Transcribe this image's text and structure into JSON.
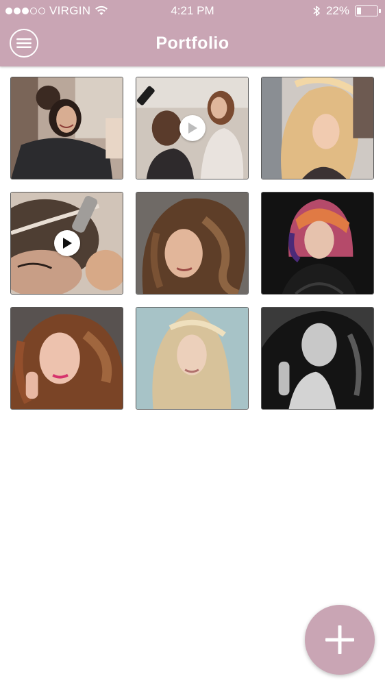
{
  "status_bar": {
    "carrier": "VIRGIN",
    "signal_bars_filled": 3,
    "signal_bars_total": 5,
    "time": "4:21 PM",
    "battery_percent_text": "22%",
    "battery_level": 0.22
  },
  "nav": {
    "title": "Portfolio",
    "menu_icon": "hamburger-menu-icon"
  },
  "colors": {
    "header_bg": "#c9a5b4",
    "fab_bg": "#c9a5b4"
  },
  "portfolio": {
    "items": [
      {
        "kind": "photo",
        "subject": "salon client smiling"
      },
      {
        "kind": "video",
        "subject": "stylist spraying hair",
        "overlay_icon": "play-icon"
      },
      {
        "kind": "photo",
        "subject": "blonde hair styling"
      },
      {
        "kind": "video",
        "subject": "hair parting treatment",
        "overlay_icon": "play-icon"
      },
      {
        "kind": "photo",
        "subject": "brunette wavy hair"
      },
      {
        "kind": "photo",
        "subject": "pink and orange bob"
      },
      {
        "kind": "photo",
        "subject": "auburn curly hair"
      },
      {
        "kind": "photo",
        "subject": "long blonde hair"
      },
      {
        "kind": "photo",
        "subject": "black and white portrait"
      }
    ]
  },
  "fab": {
    "icon": "plus-icon"
  }
}
